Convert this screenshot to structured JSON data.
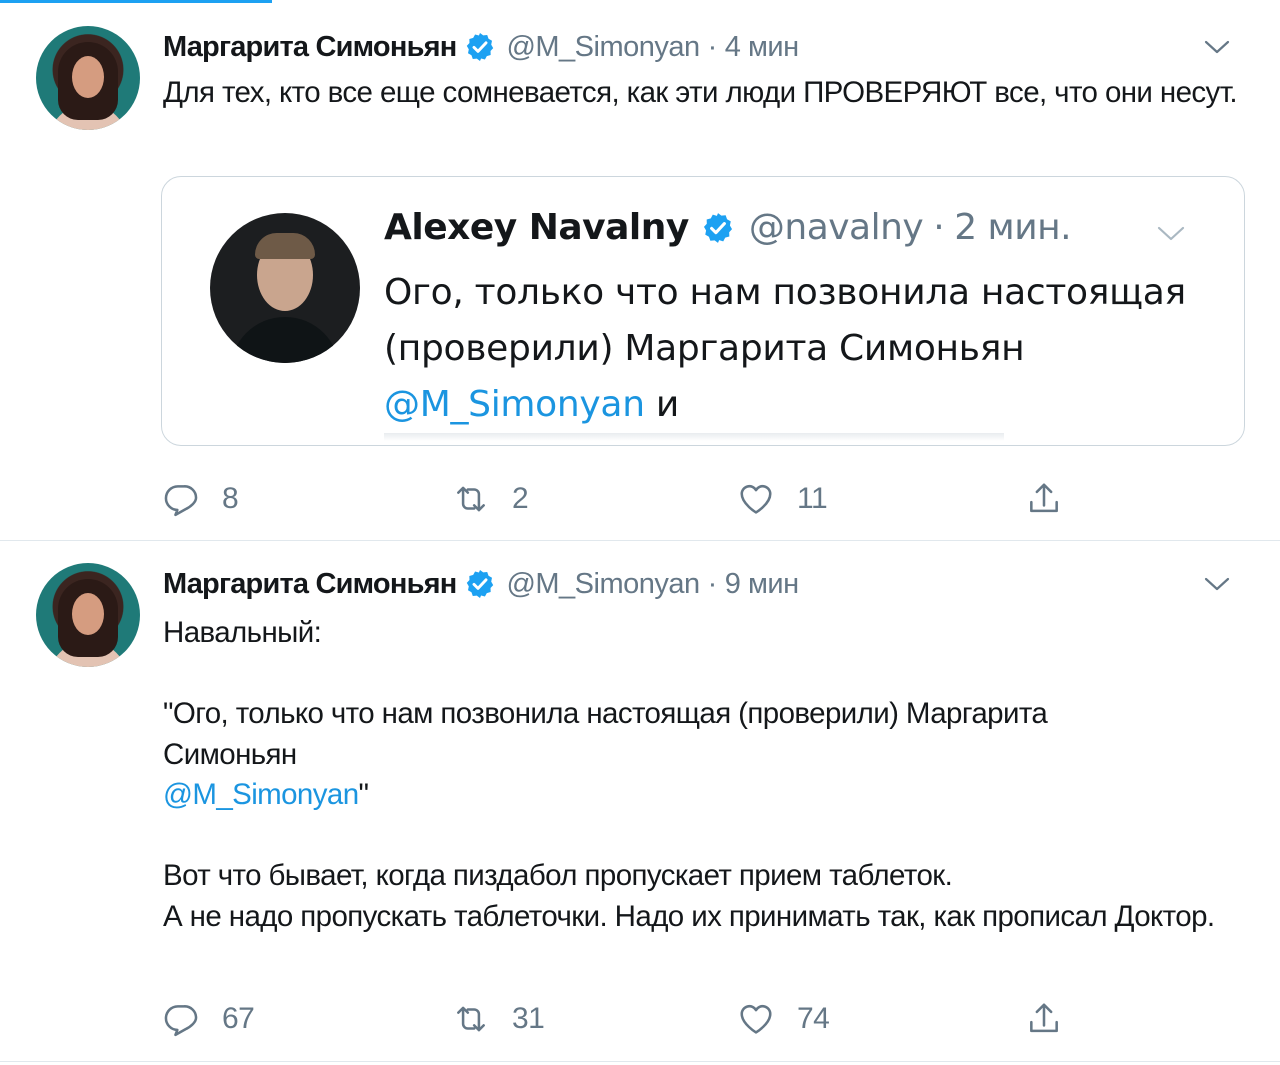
{
  "colors": {
    "accent": "#1da1f2",
    "link": "#1b95e0",
    "secondary_text": "#657786",
    "border": "#e1e8ed"
  },
  "tweets": [
    {
      "author": {
        "name": "Маргарита Симоньян",
        "handle": "@M_Simonyan"
      },
      "separator": "·",
      "time": "4 мин",
      "text": "Для тех, кто все еще сомневается, как эти люди ПРОВЕРЯЮТ все, что они несут.",
      "quoted": {
        "author": {
          "name": "Alexey Navalny",
          "handle": "@navalny"
        },
        "separator": "·",
        "time": "2 мин.",
        "text": "Ого, только что нам позвонила настоящая (проверили) Маргарита Симоньян",
        "mention": "@M_Simonyan",
        "text_end": "и"
      },
      "actions": {
        "replies": "8",
        "retweets": "2",
        "likes": "11"
      }
    },
    {
      "author": {
        "name": "Маргарита Симоньян",
        "handle": "@M_Simonyan"
      },
      "separator": "·",
      "time": "9 мин",
      "text": {
        "line1": "Навальный:",
        "quote_open": "\"Ого, только что нам позвонила настоящая (проверили) Маргарита Симоньян",
        "mention": "@M_Simonyan",
        "quote_close": "\"",
        "line3": "Вот что бывает, когда пиздабол пропускает прием таблеток.",
        "line4": "А не надо пропускать таблеточки. Надо их принимать так, как прописал Доктор."
      },
      "actions": {
        "replies": "67",
        "retweets": "31",
        "likes": "74"
      }
    }
  ]
}
